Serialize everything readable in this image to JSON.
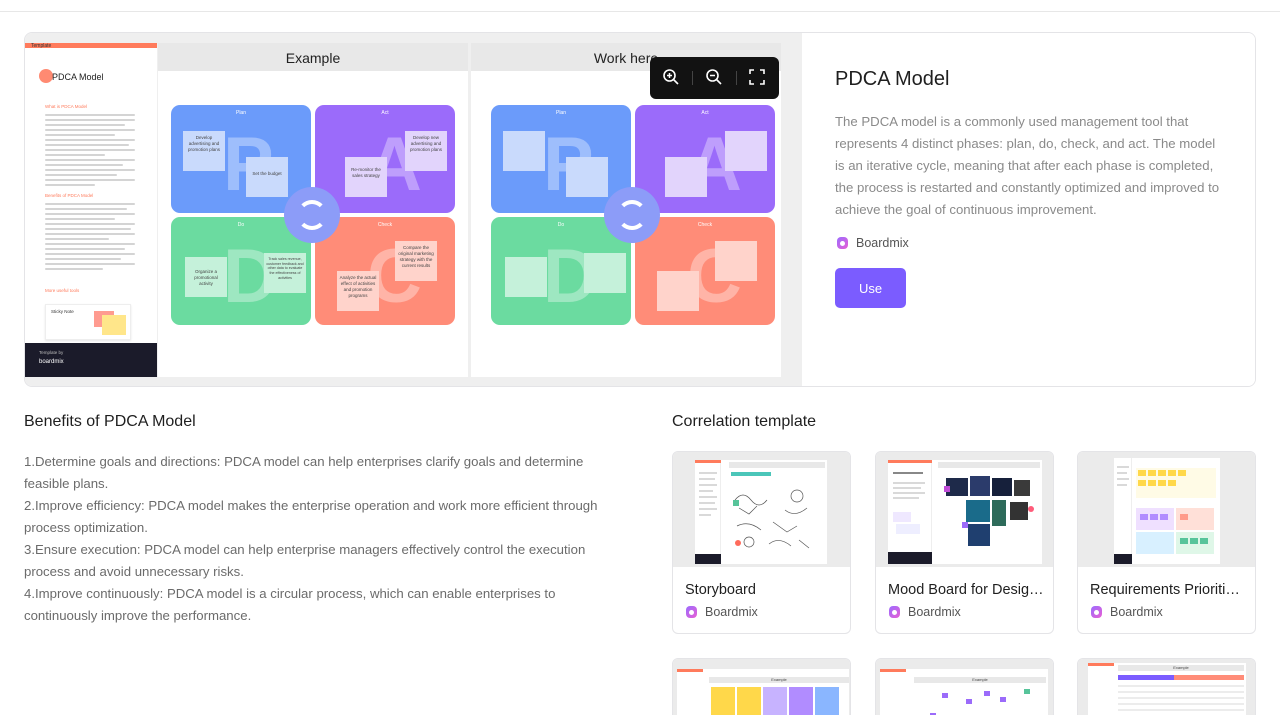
{
  "hero": {
    "template_sheet": {
      "label": "Template",
      "name": "PDCA Model",
      "section1": "What is PDCA Model",
      "section2": "Benefits of PDCA Model",
      "section3": "More useful tools",
      "tip_title": "Sticky Note",
      "footer_label": "Template by",
      "footer_brand": "boardmix"
    },
    "example_panel": {
      "title": "Example",
      "quadrants": [
        {
          "label": "Plan",
          "letter": "P",
          "color": "#6b9bfa"
        },
        {
          "label": "Act",
          "letter": "A",
          "color": "#9b6bfa"
        },
        {
          "label": "Do",
          "letter": "D",
          "color": "#6bdba0"
        },
        {
          "label": "Check",
          "letter": "C",
          "color": "#ff8c78"
        }
      ],
      "notes": [
        "Develop advertising and promotion plans",
        "Set the budget",
        "Develop new advertising and promotion plans",
        "Re-monitor the sales strategy",
        "Organize a promotional activity",
        "Track sales revenue, customer feedback and other data to evaluate the effectiveness of activities",
        "Analyze the actual effect of activities and promotion programs",
        "Compare the original marketing strategy with the current results"
      ]
    },
    "work_panel": {
      "title": "Work here",
      "quadrants": [
        {
          "label": "Plan",
          "letter": "P",
          "color": "#6b9bfa"
        },
        {
          "label": "Act",
          "letter": "A",
          "color": "#9b6bfa"
        },
        {
          "label": "Do",
          "letter": "D",
          "color": "#6bdba0"
        },
        {
          "label": "Check",
          "letter": "C",
          "color": "#ff8c78"
        }
      ]
    },
    "zoom_toolbar": {
      "zoom_in_icon": "zoom-in-icon",
      "zoom_out_icon": "zoom-out-icon",
      "fullscreen_icon": "fullscreen-icon"
    },
    "info": {
      "title": "PDCA Model",
      "description": "The PDCA model is a commonly used management tool that represents 4 distinct phases: plan, do, check, and act. The model is an iterative cycle, meaning that after each phase is completed, the process is restarted and constantly optimized and improved to achieve the goal of continuous improvement.",
      "brand": "Boardmix",
      "use_label": "Use",
      "accent_color": "#7b5cff"
    }
  },
  "benefits": {
    "heading": "Benefits of PDCA Model",
    "items": [
      "1.Determine goals and directions: PDCA model can help enterprises clarify goals and determine feasible plans.",
      "2.Improve efficiency: PDCA model makes the enterprise operation and work more efficient through process optimization.",
      "3.Ensure execution: PDCA model can help enterprise managers effectively control the execution process and avoid unnecessary risks.",
      "4.Improve continuously: PDCA model is a circular process, which can enable enterprises to continuously improve the performance."
    ]
  },
  "correlation": {
    "heading": "Correlation template",
    "cards": [
      {
        "name": "Storyboard",
        "brand": "Boardmix"
      },
      {
        "name": "Mood Board for Design Team",
        "brand": "Boardmix"
      },
      {
        "name": "Requirements Prioritization",
        "brand": "Boardmix"
      }
    ],
    "partial_thumbs": [
      {
        "header": "Example"
      },
      {
        "header": "Example"
      },
      {
        "header": "Example"
      }
    ]
  }
}
